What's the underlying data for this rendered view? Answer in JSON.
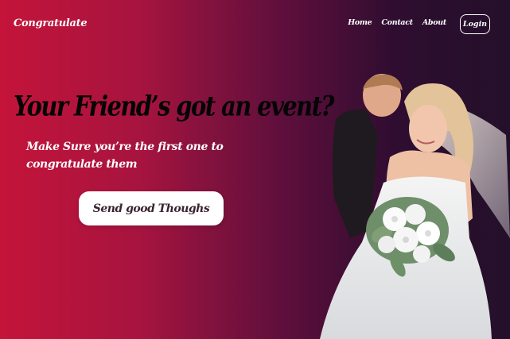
{
  "header": {
    "brand": "Congratulate",
    "nav": {
      "home": "Home",
      "contact": "Contact",
      "about": "About"
    },
    "login": "Login"
  },
  "hero": {
    "title": "Your Friend’s got an event?",
    "subtitle": "Make Sure you’re the first one to congratulate them",
    "cta": "Send good Thoughs"
  },
  "colors": {
    "gradient_left": "#c4143a",
    "gradient_right": "#24102a",
    "title_text": "#050505",
    "button_bg": "#ffffff",
    "button_text": "#3a2230"
  },
  "image": {
    "subject": "wedding-couple-photo"
  }
}
